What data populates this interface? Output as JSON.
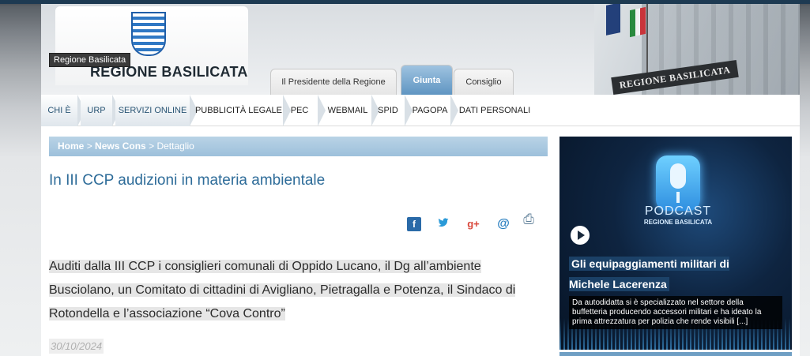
{
  "header": {
    "logo_title": "REGIONE BASILICATA",
    "logo_tooltip": "Regione Basilicata",
    "photo_sign": "REGIONE BASILICATA",
    "tabs": [
      {
        "label": "Il Presidente della Regione"
      },
      {
        "label": "Giunta"
      },
      {
        "label": "Consiglio"
      }
    ]
  },
  "nav": {
    "items": [
      {
        "label": "CHI È"
      },
      {
        "label": "URP"
      },
      {
        "label": "SERVIZI ONLINE"
      },
      {
        "label": "PUBBLICITÀ LEGALE"
      },
      {
        "label": "PEC"
      },
      {
        "label": "WEBMAIL"
      },
      {
        "label": "SPID"
      },
      {
        "label": "PAGOPA"
      },
      {
        "label": "DATI PERSONALI"
      }
    ]
  },
  "breadcrumb": {
    "home": "Home",
    "sep": ">",
    "news": "News Cons",
    "current": "Dettaglio"
  },
  "article": {
    "title": "In III CCP audizioni in materia ambientale",
    "body": "Auditi dalla III CCP i consiglieri comunali di Oppido Lucano, il Dg all’ambiente Busciolano, un Comitato di cittadini di Avigliano, Pietragalla e Potenza, il Sindaco di Rotondella e l’associazione “Cova Contro”",
    "date": "30/10/2024",
    "share_icons": {
      "facebook": "f",
      "twitter": "🐦",
      "googleplus": "g+",
      "email": "@",
      "print": "⎙"
    }
  },
  "podcast": {
    "label": "PODCAST",
    "sublabel": "REGIONE BASILICATA",
    "title": "Gli equipaggiamenti militari di Michele Lacerenza",
    "description": "Da autodidatta si è specializzato nel settore della buffetteria producendo accessori militari e ha ideato la prima attrezzatura per polizia che rende visibili [...]"
  },
  "colors": {
    "accent_blue": "#2e6c99",
    "tab_active": "#5f95c2",
    "breadcrumb_bg": "#9dc0db"
  }
}
